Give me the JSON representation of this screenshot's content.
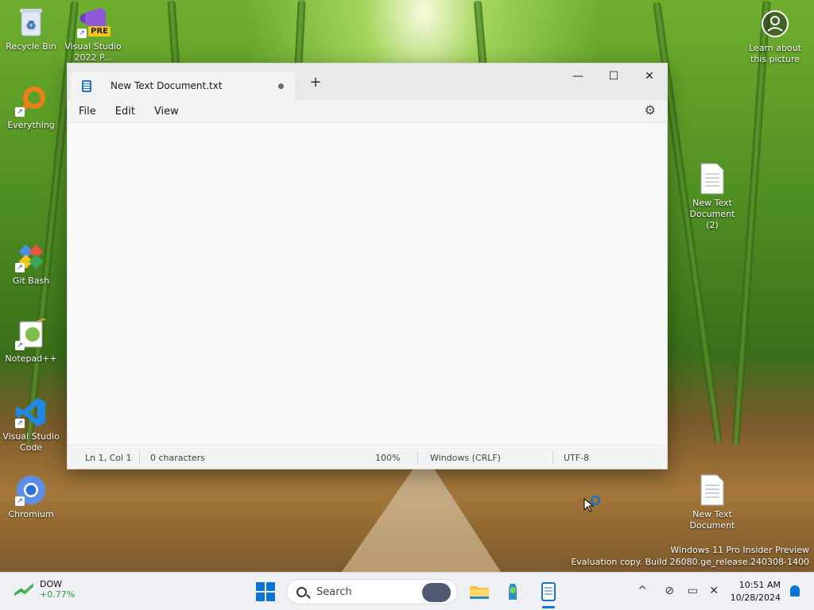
{
  "desktop": {
    "icons_left": [
      {
        "label": "Recycle Bin"
      },
      {
        "label": "Visual Studio 2022 P...",
        "badge": "PRE"
      },
      {
        "label": "Everything"
      },
      {
        "label": "Git Bash"
      },
      {
        "label": "Notepad++"
      },
      {
        "label": "Visual Studio Code"
      },
      {
        "label": "Chromium"
      }
    ],
    "icons_right": [
      {
        "label": "Learn about this picture"
      },
      {
        "label": "New Text Document (2)"
      },
      {
        "label": "New Text Document"
      }
    ],
    "watermark": {
      "line1": "Windows 11 Pro Insider Preview",
      "line2": "Evaluation copy. Build 26080.ge_release.240308-1400"
    }
  },
  "notepad": {
    "tab_title": "New Text Document.txt",
    "new_tab": "+",
    "window_buttons": {
      "minimize": "—",
      "maximize": "☐",
      "close": "✕"
    },
    "menu": [
      "File",
      "Edit",
      "View"
    ],
    "content": "",
    "status": {
      "position": "Ln 1, Col 1",
      "chars": "0 characters",
      "zoom": "100%",
      "line_ending": "Windows (CRLF)",
      "encoding": "UTF-8"
    }
  },
  "taskbar": {
    "widget": {
      "name": "DOW",
      "value": "+0.77%"
    },
    "search_placeholder": "Search",
    "clock": {
      "time": "10:51 AM",
      "date": "10/28/2024"
    },
    "tray": {
      "chevron": "^"
    }
  }
}
